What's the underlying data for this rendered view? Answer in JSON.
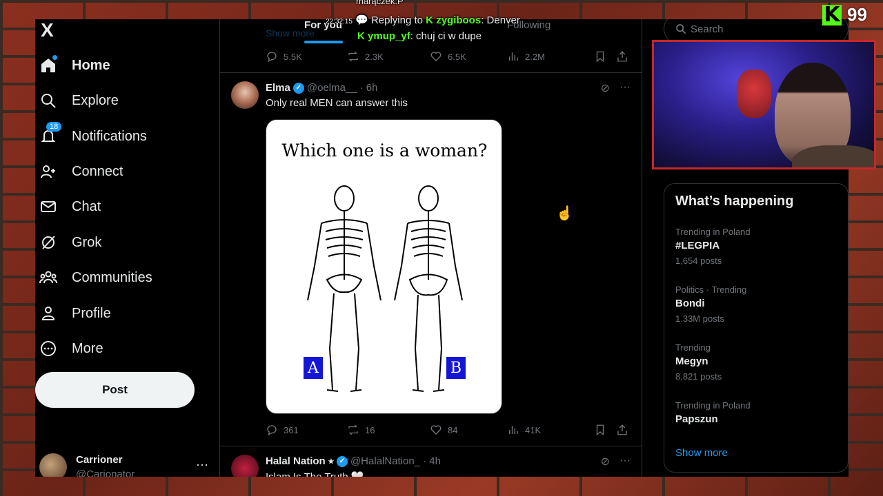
{
  "overlay": {
    "top_user": "marączek.P",
    "timestamp": "22:32:15",
    "chat": [
      {
        "prefix": "💬 Replying to ",
        "user": "zygiboos",
        "text": "Denver"
      },
      {
        "user": "ymup_yf",
        "text": "chuj ci w dupe"
      }
    ],
    "viewer_count": "99",
    "kick_logo": "K"
  },
  "nav": {
    "logo": "X",
    "items": [
      {
        "label": "Home",
        "icon": "home-icon"
      },
      {
        "label": "Explore",
        "icon": "search-icon"
      },
      {
        "label": "Notifications",
        "icon": "bell-icon",
        "badge": "18"
      },
      {
        "label": "Connect",
        "icon": "person-add-icon"
      },
      {
        "label": "Chat",
        "icon": "envelope-icon"
      },
      {
        "label": "Grok",
        "icon": "grok-icon"
      },
      {
        "label": "Communities",
        "icon": "communities-icon"
      },
      {
        "label": "Profile",
        "icon": "person-icon"
      },
      {
        "label": "More",
        "icon": "more-circle-icon"
      }
    ],
    "post_label": "Post",
    "account": {
      "name": "Carrioner",
      "handle": "@Carionator",
      "more": "···"
    }
  },
  "feed": {
    "tabs": [
      "For you",
      "Following"
    ],
    "partial_top_text": "Show more",
    "top_stats": {
      "replies": "5.5K",
      "reposts": "2.3K",
      "likes": "6.5K",
      "views": "2.2M"
    },
    "tweet": {
      "name": "Elma",
      "handle": "@oelma__",
      "time": "· 6h",
      "text": "Only real MEN can answer this",
      "image_title": "Which one is a woman?",
      "choice_a": "A",
      "choice_b": "B",
      "stats": {
        "replies": "361",
        "reposts": "16",
        "likes": "84",
        "views": "41K"
      }
    },
    "next_tweet": {
      "name": "Halal Nation ⭑",
      "handle": "@HalalNation_",
      "time": "· 4h",
      "text": "Islam Is The Truth 🤍"
    }
  },
  "right": {
    "search_placeholder": "Search",
    "trends_title": "What’s happening",
    "trends": [
      {
        "context": "Trending in Poland",
        "name": "#LEGPIA",
        "count": "1,654 posts"
      },
      {
        "context": "Politics · Trending",
        "name": "Bondi",
        "count": "1.33M posts"
      },
      {
        "context": "Trending",
        "name": "Megyn",
        "count": "8,821 posts"
      },
      {
        "context": "Trending in Poland",
        "name": "Papszun",
        "count": ""
      }
    ],
    "show_more": "Show more"
  }
}
